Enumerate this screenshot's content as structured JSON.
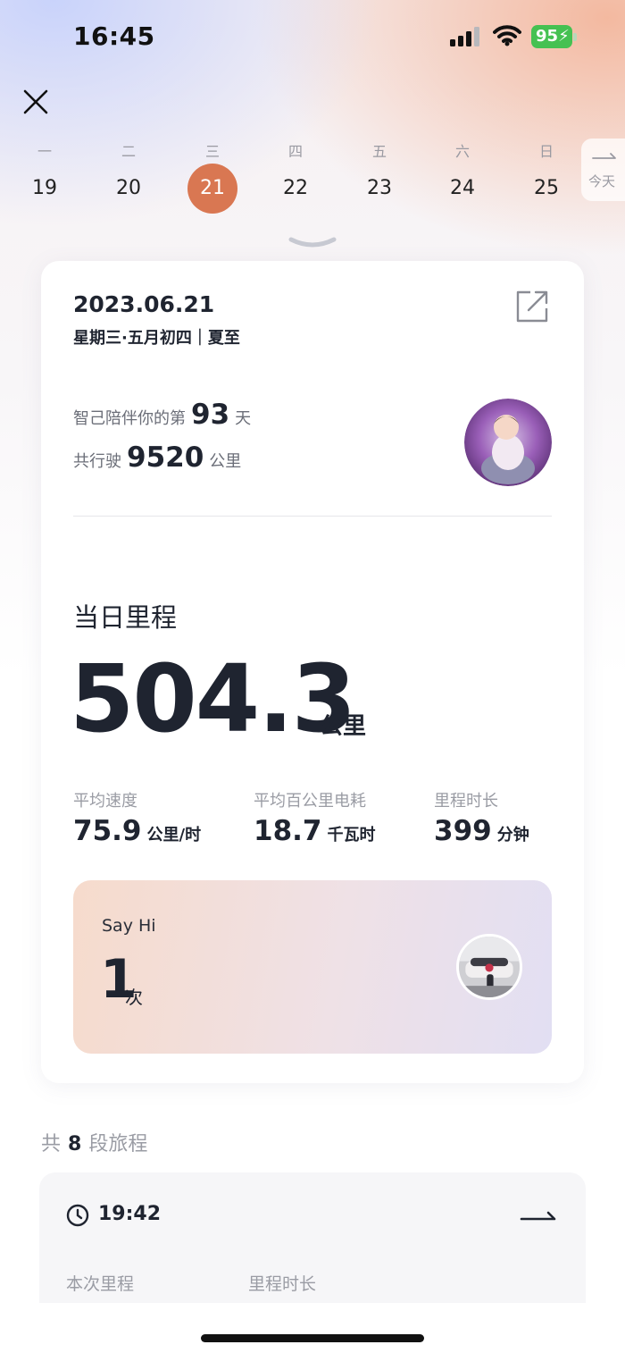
{
  "status_bar": {
    "time": "16:45",
    "battery_level": "95",
    "battery_color": "#45c152"
  },
  "week": {
    "weekdays": [
      "一",
      "二",
      "三",
      "四",
      "五",
      "六",
      "日"
    ],
    "days": [
      "19",
      "20",
      "21",
      "22",
      "23",
      "24",
      "25"
    ],
    "selected_day": "21",
    "selected_color": "#d97752",
    "today_label": "今天"
  },
  "summary": {
    "date": "2023.06.21",
    "lunar": "星期三·五月初四｜夏至",
    "companion_prefix": "智己陪伴你的第",
    "companion_days": "93",
    "companion_suffix": "天",
    "total_prefix": "共行驶",
    "total_km": "9520",
    "total_suffix": "公里"
  },
  "daily": {
    "title": "当日里程",
    "mileage": "504.3",
    "mileage_unit": "公里",
    "metrics": [
      {
        "label": "平均速度",
        "value": "75.9",
        "unit": "公里/时"
      },
      {
        "label": "平均百公里电耗",
        "value": "18.7",
        "unit": "千瓦时"
      },
      {
        "label": "里程时长",
        "value": "399",
        "unit": "分钟"
      }
    ]
  },
  "say_hi": {
    "label": "Say Hi",
    "count": "1",
    "unit": "次"
  },
  "trips": {
    "prefix": "共",
    "count": "8",
    "suffix": "段旅程",
    "first": {
      "time": "19:42",
      "label_distance": "本次里程",
      "label_duration": "里程时长"
    }
  },
  "icons": [
    "close-icon",
    "share-icon",
    "clock-icon",
    "arrow-right-icon",
    "chevron-down-icon",
    "signal-icon",
    "wifi-icon",
    "battery-icon"
  ]
}
